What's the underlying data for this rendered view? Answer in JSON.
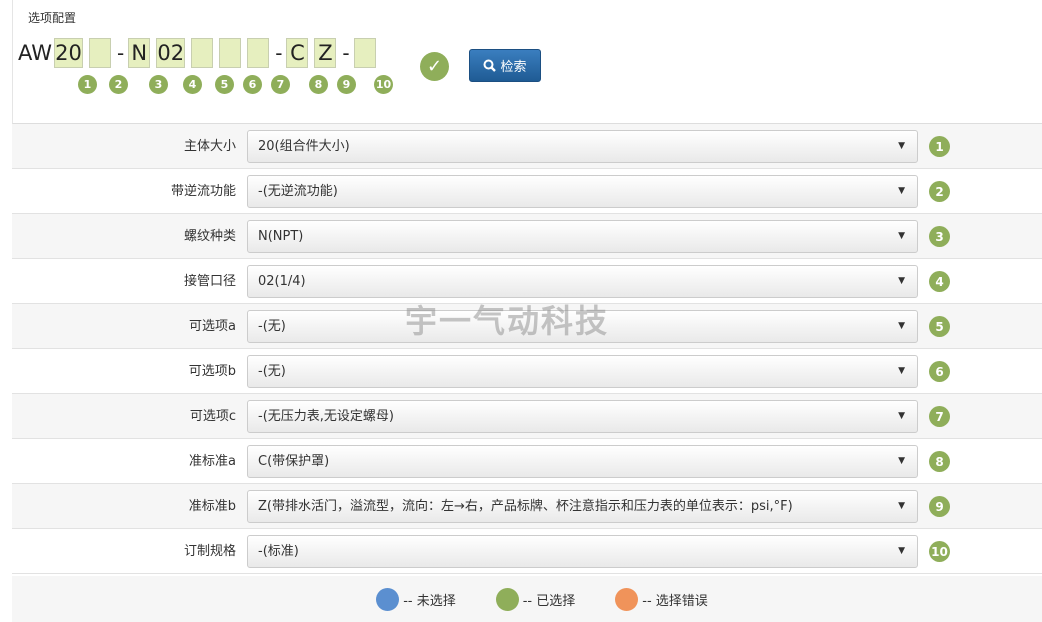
{
  "header": {
    "title": "选项配置",
    "prefix": "AW",
    "search_label": "检索"
  },
  "code_boxes": [
    {
      "value": "20",
      "badge": "1"
    },
    {
      "value": "",
      "badge": "2"
    },
    {
      "value": "N",
      "badge": "3"
    },
    {
      "value": "02",
      "badge": "4"
    },
    {
      "value": "",
      "badge": "5"
    },
    {
      "value": "",
      "badge": "6"
    },
    {
      "value": "",
      "badge": "7"
    },
    {
      "value": "C",
      "badge": "8"
    },
    {
      "value": "Z",
      "badge": "9"
    },
    {
      "value": "",
      "badge": "10"
    }
  ],
  "separator": "-",
  "options": [
    {
      "label": "主体大小",
      "value": "20(组合件大小)",
      "badge": "1"
    },
    {
      "label": "带逆流功能",
      "value": "-(无逆流功能)",
      "badge": "2"
    },
    {
      "label": "螺纹种类",
      "value": "N(NPT)",
      "badge": "3"
    },
    {
      "label": "接管口径",
      "value": "02(1/4)",
      "badge": "4"
    },
    {
      "label": "可选项a",
      "value": "-(无)",
      "badge": "5"
    },
    {
      "label": "可选项b",
      "value": "-(无)",
      "badge": "6"
    },
    {
      "label": "可选项c",
      "value": "-(无压力表,无设定螺母)",
      "badge": "7"
    },
    {
      "label": "准标准a",
      "value": "C(带保护罩)",
      "badge": "8"
    },
    {
      "label": "准标准b",
      "value": "Z(带排水活门，溢流型，流向：左→右，产品标牌、杯注意指示和压力表的单位表示：psi,°F)",
      "badge": "9"
    },
    {
      "label": "订制规格",
      "value": "-(标准)",
      "badge": "10"
    }
  ],
  "legend": [
    {
      "label": "-- 未选择",
      "color": "#5b8fd0"
    },
    {
      "label": "-- 已选择",
      "color": "#8fae5a"
    },
    {
      "label": "-- 选择错误",
      "color": "#f0935a"
    }
  ],
  "watermark": "宇一气动科技"
}
